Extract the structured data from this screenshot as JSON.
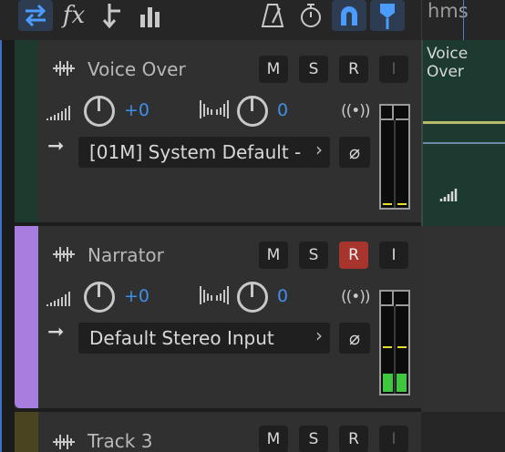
{
  "toolbar": {
    "tools": [
      {
        "name": "swap-icon",
        "active": true
      },
      {
        "name": "fx-icon",
        "label": "fx"
      },
      {
        "name": "route-down-icon"
      },
      {
        "name": "levels-icon"
      },
      {
        "name": "metronome-icon"
      },
      {
        "name": "timer-icon"
      },
      {
        "name": "snap-magnet-icon",
        "active": true
      },
      {
        "name": "marker-pin-icon",
        "active": true
      }
    ]
  },
  "ruler": {
    "label": "hms"
  },
  "tracks": [
    {
      "name": "Voice Over",
      "color": "#1e3a2f",
      "buttons": {
        "m": "M",
        "s": "S",
        "r": "R",
        "i": "I"
      },
      "record_armed": false,
      "volume": "+0",
      "pan": "0",
      "input": "[01M] System Default -",
      "meter": {
        "peak": 0.03,
        "level": 0
      }
    },
    {
      "name": "Narrator",
      "color": "#a77ee0",
      "buttons": {
        "m": "M",
        "s": "S",
        "r": "R",
        "i": "I"
      },
      "record_armed": true,
      "volume": "+0",
      "pan": "0",
      "input": "Default Stereo Input",
      "meter": {
        "peak": 0.45,
        "level": 0.2
      }
    },
    {
      "name": "Track 3",
      "color": "#4a4420",
      "buttons": {
        "m": "M",
        "s": "S",
        "r": "R",
        "i": "I"
      }
    }
  ],
  "timeline": {
    "clip_name": "Voice Over"
  },
  "colors": {
    "accent_blue": "#3d8fe8",
    "record_red": "#a8352d",
    "meter_green": "#3ec83e",
    "peak_yellow": "#e8e030"
  }
}
